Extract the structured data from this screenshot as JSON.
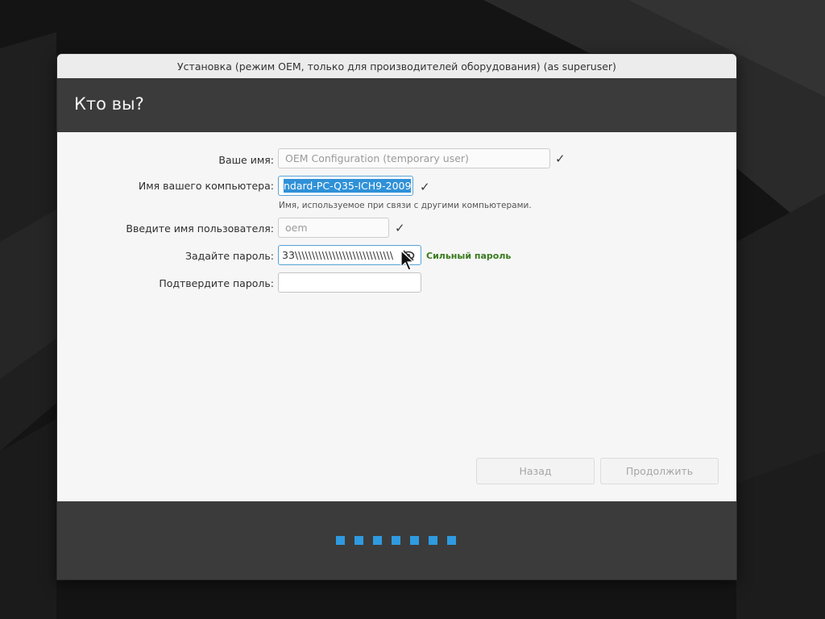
{
  "window": {
    "title": "Установка (режим OEM, только для производителей оборудования) (as superuser)"
  },
  "header": {
    "title": "Кто вы?"
  },
  "form": {
    "name": {
      "label": "Ваше имя:",
      "value": "OEM Configuration (temporary user)",
      "valid": true
    },
    "computer": {
      "label": "Имя вашего компьютера:",
      "value_visible": "ndard-PC-Q35-ICH9-2009",
      "hint": "Имя, используемое при связи с другими компьютерами.",
      "valid": true
    },
    "username": {
      "label": "Введите имя пользователя:",
      "value": "oem",
      "valid": true
    },
    "password": {
      "label": "Задайте пароль:",
      "value_visible": "33\\\\\\\\\\\\\\\\\\\\\\\\\\\\\\\\\\\\\\\\\\\\\\\\\\\\\\\\\\",
      "strength": "Сильный пароль",
      "reveal_icon": "eye-crossed-icon"
    },
    "confirm": {
      "label": "Подтвердите пароль:",
      "value": ""
    }
  },
  "buttons": {
    "back": "Назад",
    "continue": "Продолжить"
  },
  "progress": {
    "total_steps": 7
  },
  "colors": {
    "header_bg": "#3b3b3b",
    "accent": "#2f91d8",
    "strength_text": "#3a7a1e"
  }
}
